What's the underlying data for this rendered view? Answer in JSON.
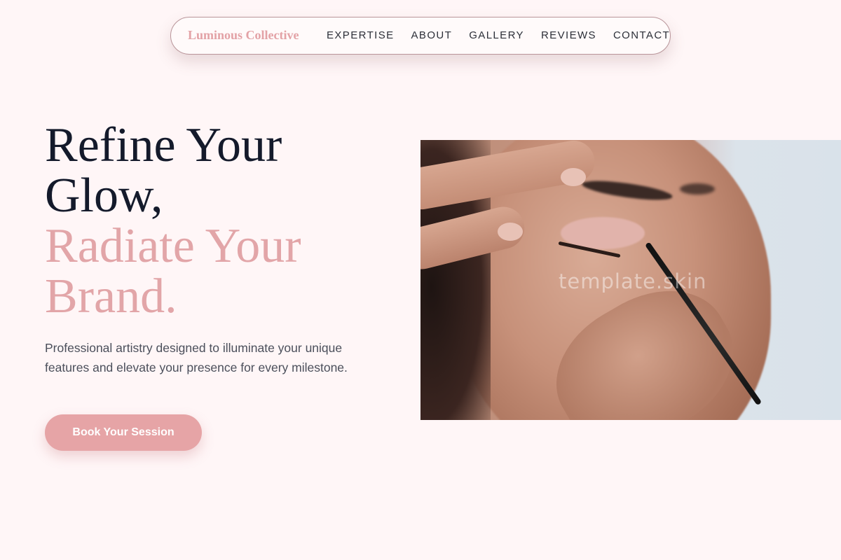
{
  "nav": {
    "brand": "Luminous Collective",
    "links": [
      "EXPERTISE",
      "ABOUT",
      "GALLERY",
      "REVIEWS",
      "CONTACT"
    ]
  },
  "hero": {
    "title_line1": "Refine Your",
    "title_line2": "Glow,",
    "title_accent_line1": "Radiate Your",
    "title_accent_line2": "Brand.",
    "description": "Professional artistry designed to illuminate your unique features and elevate your presence for every milestone.",
    "cta_label": "Book Your Session"
  },
  "image": {
    "watermark": "template.skin",
    "subject": "makeup-application-photo"
  },
  "colors": {
    "background": "#fff6f7",
    "accent_pink": "#e6a4a6",
    "heading_dark": "#141a2b",
    "nav_text": "#2b2f38",
    "body_text": "#4b4f5b"
  }
}
